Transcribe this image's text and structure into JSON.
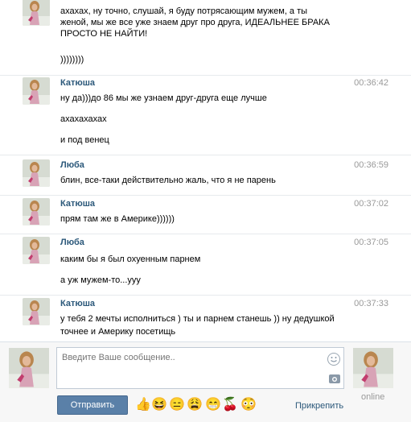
{
  "messages": [
    {
      "author": "",
      "time": "",
      "avatar": "girl-photo",
      "lines": [
        "ахахах, ну точно, слушай, я буду потрясающим мужем, а ты",
        "женой, мы же все уже знаем друг про друга, ИДЕАЛЬНЕЕ БРАКА",
        "ПРОСТО НЕ НАЙТИ!",
        "",
        "))))))))"
      ]
    },
    {
      "author": "Катюша",
      "time": "00:36:42",
      "avatar": "girl-photo",
      "lines": [
        "ну да)))до 86 мы же узнаем друг-друга еще лучше",
        "",
        "ахахахахах",
        "",
        "и под венец"
      ]
    },
    {
      "author": "Люба",
      "time": "00:36:59",
      "avatar": "girl-photo",
      "lines": [
        "блин, все-таки действительно жаль, что я не парень"
      ]
    },
    {
      "author": "Катюша",
      "time": "00:37:02",
      "avatar": "girl-photo",
      "lines": [
        "прям там же в Америке))))))"
      ]
    },
    {
      "author": "Люба",
      "time": "00:37:05",
      "avatar": "girl-photo",
      "lines": [
        "каким бы я был охуенным парнем",
        "",
        "а уж мужем-то...ууу"
      ]
    },
    {
      "author": "Катюша",
      "time": "00:37:33",
      "avatar": "girl-photo",
      "lines": [
        "у тебя 2 мечты исполниться ) ты и парнем станешь )) ну дедушкой",
        "точнее и Америку посетищь"
      ]
    }
  ],
  "composer": {
    "placeholder": "Введите Ваше сообщение..",
    "send_label": "Отправить",
    "attach_label": "Прикрепить",
    "online_label": "online",
    "emojis": [
      "👍",
      "😆",
      "😑",
      "😩",
      "😁",
      "🍒",
      "😳"
    ]
  },
  "colors": {
    "author": "#2b587a",
    "send_button": "#5a80a8",
    "time": "#999999"
  }
}
